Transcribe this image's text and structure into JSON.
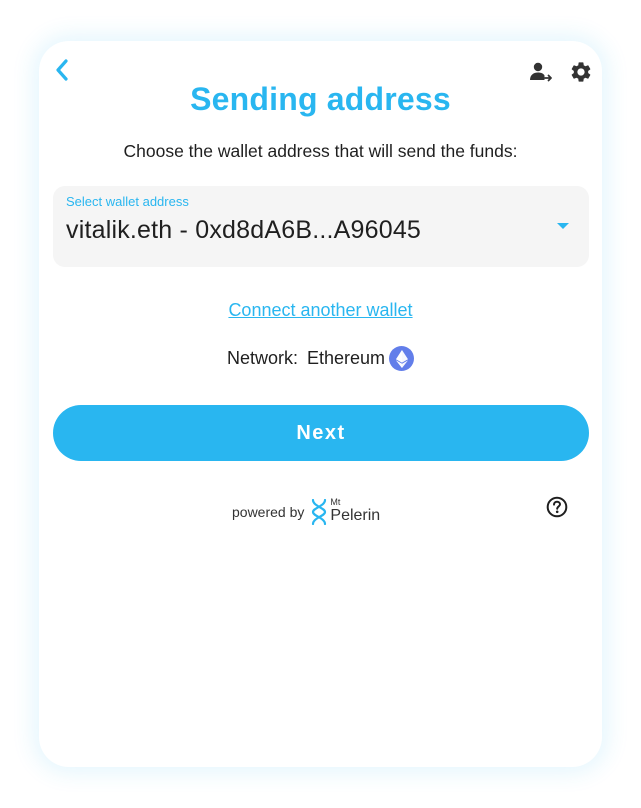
{
  "header": {
    "back_icon": "chevron-left-icon",
    "account_icon": "user-switch-icon",
    "settings_icon": "gear-icon",
    "title": "Sending address",
    "subtitle": "Choose the wallet address that will send the funds:"
  },
  "wallet_select": {
    "label": "Select wallet address",
    "value": "vitalik.eth - 0xd8dA6B...A96045"
  },
  "connect_link": "Connect another wallet",
  "network": {
    "label": "Network:",
    "value": "Ethereum",
    "icon": "ethereum-icon"
  },
  "next_button": "Next",
  "footer": {
    "powered_by": "powered by",
    "brand_prefix": "Mt",
    "brand_name": "Pelerin",
    "help_icon": "help-circle-icon"
  },
  "colors": {
    "accent": "#29b6f0",
    "text": "#1f1f1f",
    "ethereum": "#627eea",
    "field_bg": "#f5f5f5"
  }
}
